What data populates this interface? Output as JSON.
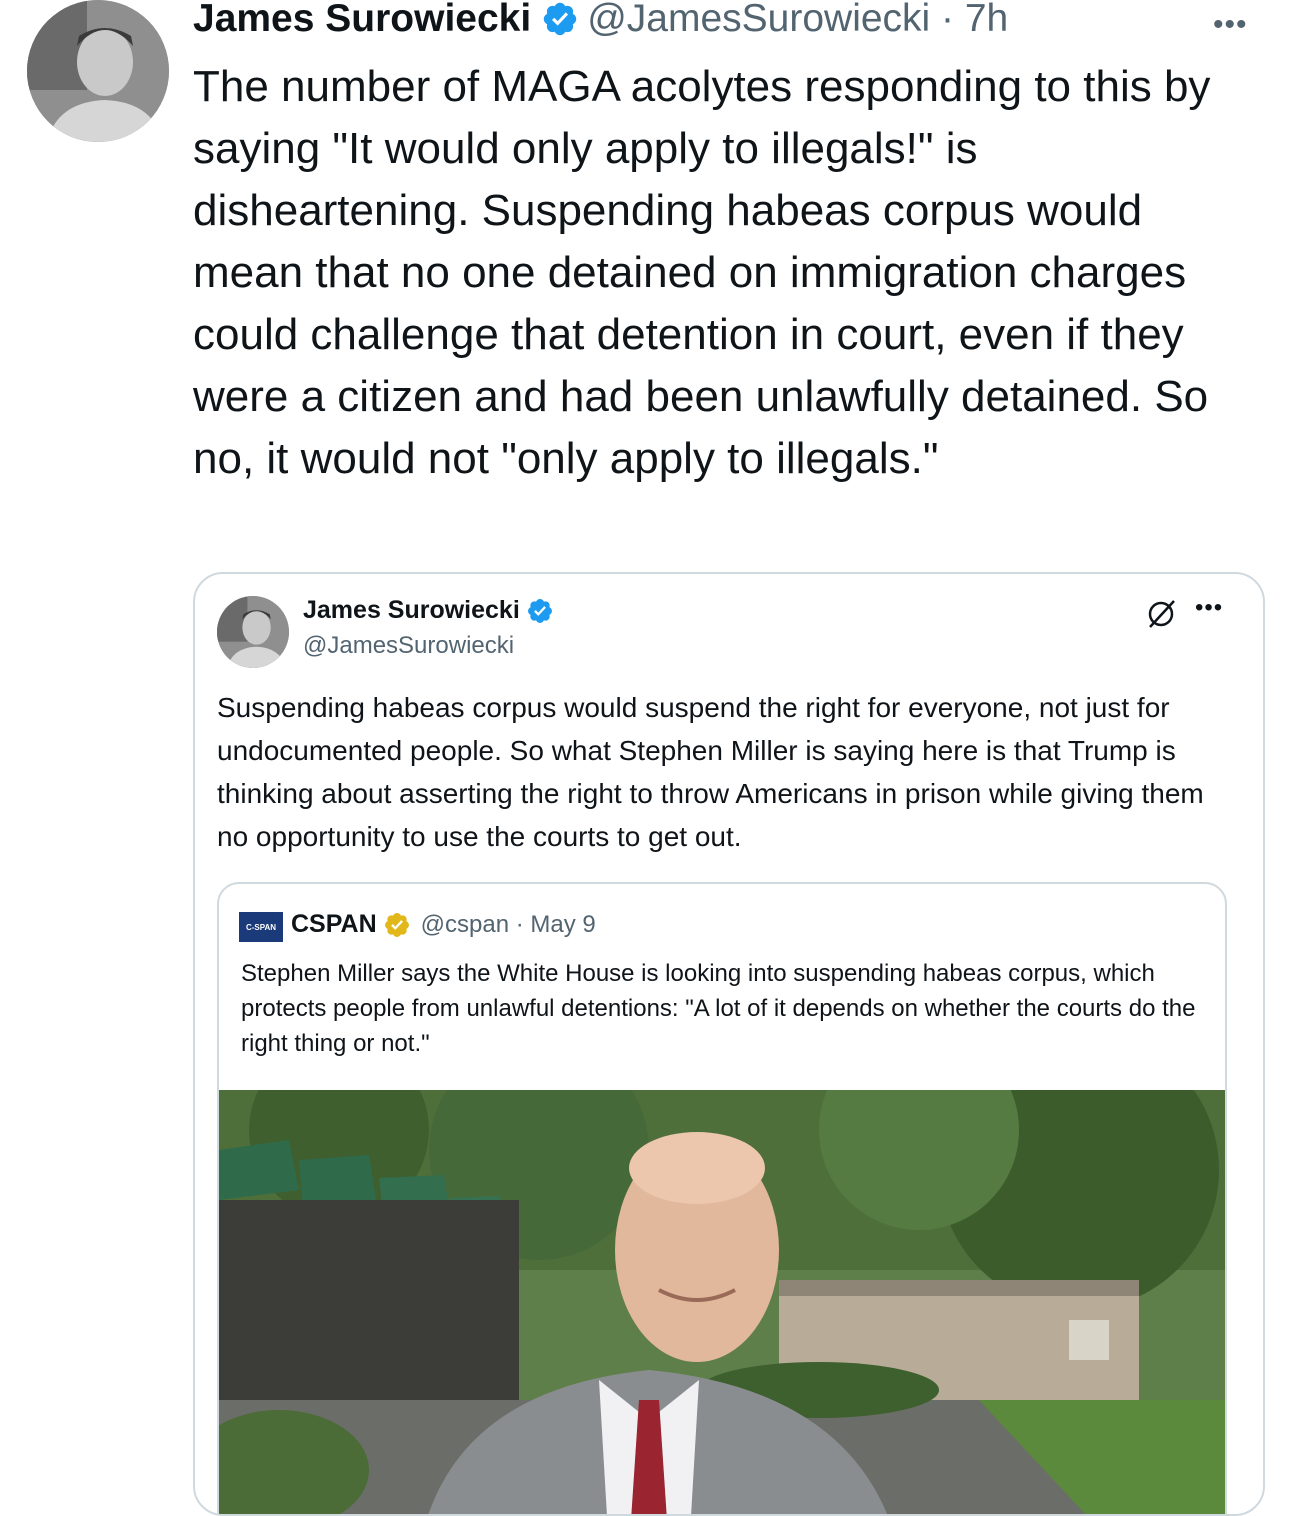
{
  "tweet": {
    "author_name": "James Surowiecki",
    "handle_time": "@JamesSurowiecki · 7h",
    "more_icon": "more-horizontal-icon",
    "text": "The number of MAGA acolytes responding to this by saying \"It would only apply to illegals!\" is disheartening. Suspending habeas corpus would mean that no one detained on immigration charges could challenge that detention in court, even if they were a citizen and had been unlawfully detained.  So no, it would not \"only apply to illegals.\""
  },
  "quoted": {
    "author_name": "James Surowiecki",
    "handle": "@JamesSurowiecki",
    "text": "Suspending habeas corpus would suspend the right for everyone, not just for undocumented people. So what Stephen Miller is saying here is that Trump is thinking about asserting the right to throw Americans in prison while giving them no opportunity to use the courts to get out.",
    "nested": {
      "logo_text": "C-SPAN",
      "author_name": "CSPAN",
      "handle_date": "@cspan · May 9",
      "text": "Stephen Miller says the White House is looking into suspending habeas corpus, which protects people from unlawful detentions: \"A lot of it depends on whether the courts do the right thing or not.\""
    }
  },
  "colors": {
    "verified_blue": "#1d9bf0",
    "verified_gold": "#e2b719",
    "muted_text": "#536471",
    "border": "#cfd9de"
  }
}
